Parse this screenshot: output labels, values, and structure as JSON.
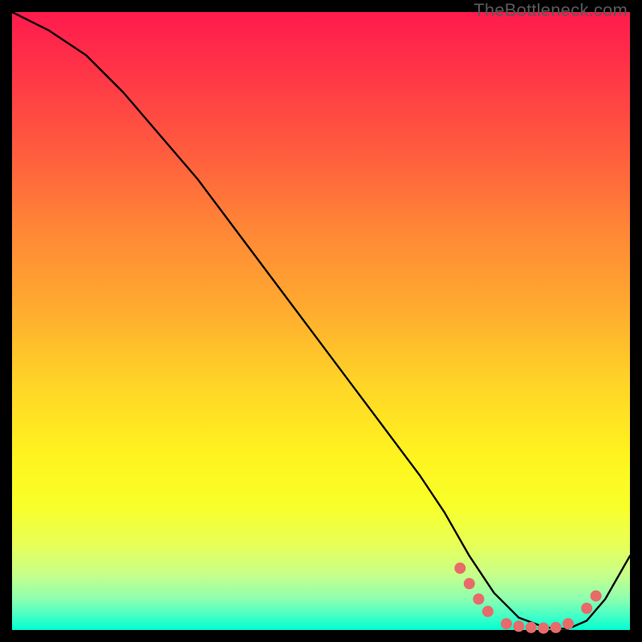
{
  "watermark": "TheBottleneck.com",
  "chart_data": {
    "type": "line",
    "title": "",
    "xlabel": "",
    "ylabel": "",
    "xlim": [
      0,
      100
    ],
    "ylim": [
      0,
      100
    ],
    "series": [
      {
        "name": "bottleneck-curve",
        "x": [
          0,
          6,
          12,
          18,
          24,
          30,
          36,
          42,
          48,
          54,
          60,
          66,
          70,
          74,
          78,
          82,
          86,
          88,
          90,
          93,
          96,
          100
        ],
        "y": [
          100,
          97,
          93,
          87,
          80,
          73,
          65,
          57,
          49,
          41,
          33,
          25,
          19,
          12,
          6,
          2,
          0.5,
          0.2,
          0.2,
          1.5,
          5,
          12
        ]
      }
    ],
    "markers": [
      {
        "x": 72.5,
        "y": 10.0
      },
      {
        "x": 74.0,
        "y": 7.5
      },
      {
        "x": 75.5,
        "y": 5.0
      },
      {
        "x": 77.0,
        "y": 3.0
      },
      {
        "x": 80.0,
        "y": 1.0
      },
      {
        "x": 82.0,
        "y": 0.6
      },
      {
        "x": 84.0,
        "y": 0.4
      },
      {
        "x": 86.0,
        "y": 0.3
      },
      {
        "x": 88.0,
        "y": 0.4
      },
      {
        "x": 90.0,
        "y": 1.0
      },
      {
        "x": 93.0,
        "y": 3.5
      },
      {
        "x": 94.5,
        "y": 5.5
      }
    ],
    "marker_color": "#e86a6a",
    "line_color": "#000000"
  }
}
